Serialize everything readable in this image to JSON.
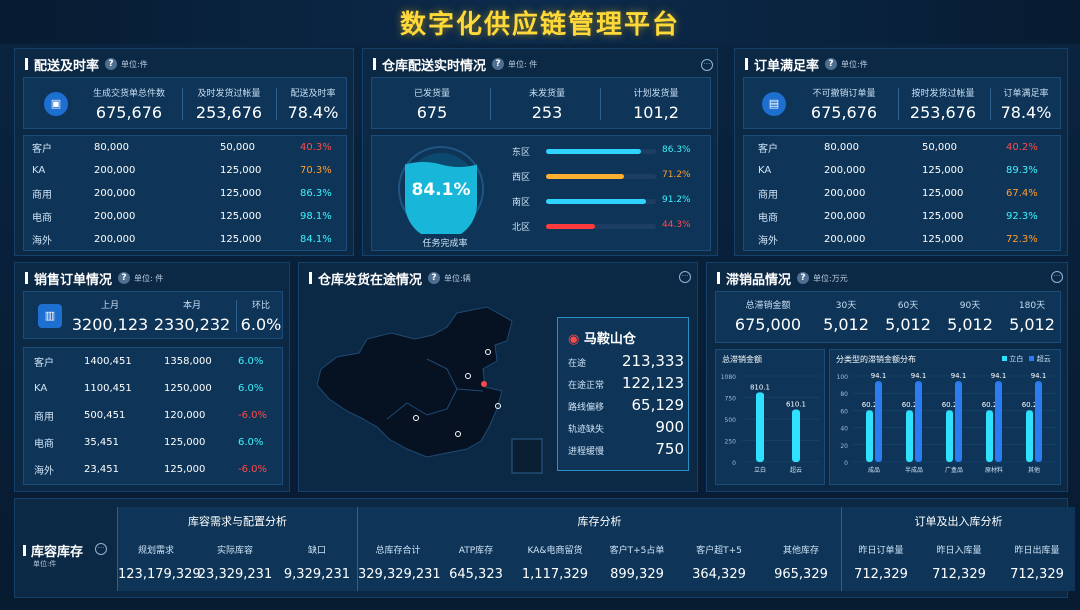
{
  "title": "数字化供应链管理平台",
  "delivery": {
    "title": "配送及时率",
    "unit": "单位:件",
    "kpis": [
      {
        "label": "生成交货单总件数",
        "value": "675,676"
      },
      {
        "label": "及时发货过帐量",
        "value": "253,676"
      },
      {
        "label": "配送及时率",
        "value": "78.4%"
      }
    ],
    "rows": [
      {
        "name": "客户",
        "a": "80,000",
        "b": "50,000",
        "c": "40.3%",
        "cc": "red"
      },
      {
        "name": "KA",
        "a": "200,000",
        "b": "125,000",
        "c": "70.3%",
        "cc": "ora"
      },
      {
        "name": "商用",
        "a": "200,000",
        "b": "125,000",
        "c": "86.3%",
        "cc": "cyn"
      },
      {
        "name": "电商",
        "a": "200,000",
        "b": "125,000",
        "c": "98.1%",
        "cc": "cyn"
      },
      {
        "name": "海外",
        "a": "200,000",
        "b": "125,000",
        "c": "84.1%",
        "cc": "cyn"
      }
    ]
  },
  "warehouse": {
    "title": "仓库配送实时情况",
    "unit": "单位: 件",
    "kpis": [
      {
        "label": "已发货量",
        "value": "675"
      },
      {
        "label": "未发货量",
        "value": "253"
      },
      {
        "label": "计划发货量",
        "value": "101,2"
      }
    ],
    "gauge": {
      "value": "84.1%",
      "label": "任务完成率",
      "fraction": 0.841
    },
    "regions": [
      {
        "name": "东区",
        "pct": "86.3%",
        "frac": 0.863,
        "color": "#2fd3ff",
        "tc": "cyn"
      },
      {
        "name": "西区",
        "pct": "71.2%",
        "frac": 0.712,
        "color": "#ffb02e",
        "tc": "ora"
      },
      {
        "name": "南区",
        "pct": "91.2%",
        "frac": 0.912,
        "color": "#2fd3ff",
        "tc": "cyn"
      },
      {
        "name": "北区",
        "pct": "44.3%",
        "frac": 0.443,
        "color": "#ff3a3a",
        "tc": "red"
      }
    ]
  },
  "order": {
    "title": "订单满足率",
    "unit": "单位:件",
    "kpis": [
      {
        "label": "不可撤销订单量",
        "value": "675,676"
      },
      {
        "label": "按时发货过帐量",
        "value": "253,676"
      },
      {
        "label": "订单满足率",
        "value": "78.4%"
      }
    ],
    "rows": [
      {
        "name": "客户",
        "a": "80,000",
        "b": "50,000",
        "c": "40.2%",
        "cc": "red"
      },
      {
        "name": "KA",
        "a": "200,000",
        "b": "125,000",
        "c": "89.3%",
        "cc": "cyn"
      },
      {
        "name": "商用",
        "a": "200,000",
        "b": "125,000",
        "c": "67.4%",
        "cc": "ora"
      },
      {
        "name": "电商",
        "a": "200,000",
        "b": "125,000",
        "c": "92.3%",
        "cc": "cyn"
      },
      {
        "name": "海外",
        "a": "200,000",
        "b": "125,000",
        "c": "72.3%",
        "cc": "ora"
      }
    ]
  },
  "sales": {
    "title": "销售订单情况",
    "unit": "单位: 件",
    "kpis": [
      {
        "label": "上月",
        "value": "3200,123"
      },
      {
        "label": "本月",
        "value": "2330,232"
      },
      {
        "label": "环比",
        "value": "6.0%"
      }
    ],
    "rows": [
      {
        "name": "客户",
        "a": "1400,451",
        "b": "1358,000",
        "c": "6.0%",
        "cc": "cyn"
      },
      {
        "name": "KA",
        "a": "1100,451",
        "b": "1250,000",
        "c": "6.0%",
        "cc": "cyn"
      },
      {
        "name": "商用",
        "a": "500,451",
        "b": "120,000",
        "c": "-6.0%",
        "cc": "red"
      },
      {
        "name": "电商",
        "a": "35,451",
        "b": "125,000",
        "c": "6.0%",
        "cc": "cyn"
      },
      {
        "name": "海外",
        "a": "23,451",
        "b": "125,000",
        "c": "-6.0%",
        "cc": "red"
      }
    ]
  },
  "transit": {
    "title": "仓库发货在途情况",
    "unit": "单位:辆",
    "card": {
      "name": "马鞍山仓",
      "items": [
        {
          "label": "在途",
          "value": "213,333"
        },
        {
          "label": "在途正常",
          "value": "122,123"
        },
        {
          "label": "路线偏移",
          "value": "65,129"
        },
        {
          "label": "轨迹缺失",
          "value": "900"
        },
        {
          "label": "进程缓慢",
          "value": "750"
        }
      ]
    }
  },
  "slow": {
    "title": "滞销品情况",
    "unit": "单位:万元",
    "kpis": [
      {
        "label": "总滞销金额",
        "value": "675,000"
      },
      {
        "label": "30天",
        "value": "5,012"
      },
      {
        "label": "60天",
        "value": "5,012"
      },
      {
        "label": "90天",
        "value": "5,012"
      },
      {
        "label": "180天",
        "value": "5,012"
      }
    ],
    "chart1": {
      "title": "总滞销金额",
      "ticks": [
        "1080",
        "750",
        "500",
        "250",
        "0"
      ]
    },
    "chart2": {
      "title": "分类型的滞销金额分布",
      "legend": [
        "立白",
        "超云"
      ]
    }
  },
  "chart_data": [
    {
      "type": "bar",
      "title": "总滞销金额",
      "categories": [
        "立白",
        "超云"
      ],
      "values": [
        810.1,
        610.1
      ],
      "ylim": [
        0,
        1000
      ]
    },
    {
      "type": "bar",
      "title": "分类型的滞销金额分布",
      "categories": [
        "成品",
        "半成品",
        "广盒品",
        "原材料",
        "其他"
      ],
      "ticks": [
        "100",
        "80",
        "60",
        "40",
        "20",
        "0"
      ],
      "series": [
        {
          "name": "立白",
          "values": [
            60.2,
            60.2,
            60.2,
            60.2,
            60.2
          ]
        },
        {
          "name": "超云",
          "values": [
            94.1,
            94.1,
            94.1,
            94.1,
            94.1
          ]
        }
      ],
      "ylim": [
        0,
        100
      ]
    }
  ],
  "inventory": {
    "title": "库容库存",
    "unit": "单位:件",
    "groups": [
      {
        "title": "库容需求与配置分析",
        "cols": [
          {
            "label": "规划需求",
            "value": "123,179,329"
          },
          {
            "label": "实际库容",
            "value": "23,329,231"
          },
          {
            "label": "缺口",
            "value": "9,329,231"
          }
        ]
      },
      {
        "title": "库存分析",
        "cols": [
          {
            "label": "总库存合计",
            "value": "329,329,231"
          },
          {
            "label": "ATP库存",
            "value": "645,323"
          },
          {
            "label": "KA&电商留货",
            "value": "1,117,329"
          },
          {
            "label": "客户T+5占单",
            "value": "899,329"
          },
          {
            "label": "客户超T+5",
            "value": "364,329"
          },
          {
            "label": "其他库存",
            "value": "965,329"
          }
        ]
      },
      {
        "title": "订单及出入库分析",
        "cols": [
          {
            "label": "昨日订单量",
            "value": "712,329"
          },
          {
            "label": "昨日入库量",
            "value": "712,329"
          },
          {
            "label": "昨日出库量",
            "value": "712,329"
          }
        ]
      }
    ]
  }
}
